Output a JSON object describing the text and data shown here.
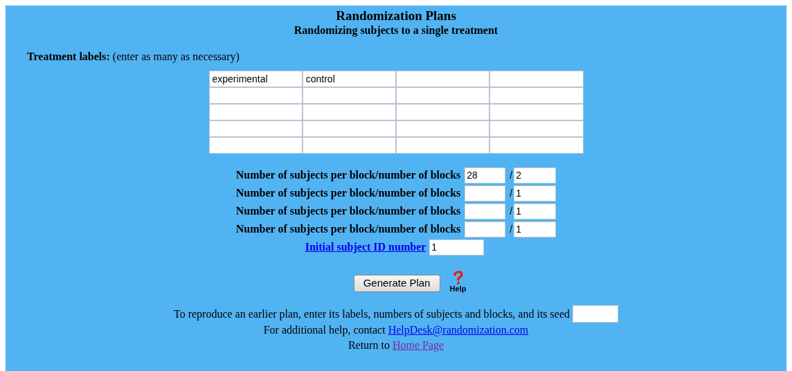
{
  "title": "Randomization Plans",
  "subtitle": "Randomizing subjects to a single treatment",
  "treatment_labels": {
    "heading": "Treatment labels:",
    "note": "(enter as many as necessary)",
    "values": [
      "experimental",
      "control"
    ]
  },
  "block_rows": [
    {
      "label": "Number of subjects per block/number of blocks",
      "subjects": "28",
      "separator": "/",
      "blocks": "2"
    },
    {
      "label": "Number of subjects per block/number of blocks",
      "separator": "/",
      "blocks": "1"
    },
    {
      "label": "Number of subjects per block/number of blocks",
      "separator": "/",
      "blocks": "1"
    },
    {
      "label": "Number of subjects per block/number of blocks",
      "separator": "/",
      "blocks": "1"
    }
  ],
  "initial_id": {
    "label": "Initial subject ID number",
    "value": "1"
  },
  "generate_button": "Generate Plan",
  "help_label": "Help",
  "seed_prompt": "To reproduce an earlier plan, enter its labels, numbers of subjects and blocks, and its seed",
  "contact": {
    "text": "For additional help, contact",
    "link": "HelpDesk@randomization.com"
  },
  "return": {
    "text": "Return to",
    "link": "Home Page"
  }
}
